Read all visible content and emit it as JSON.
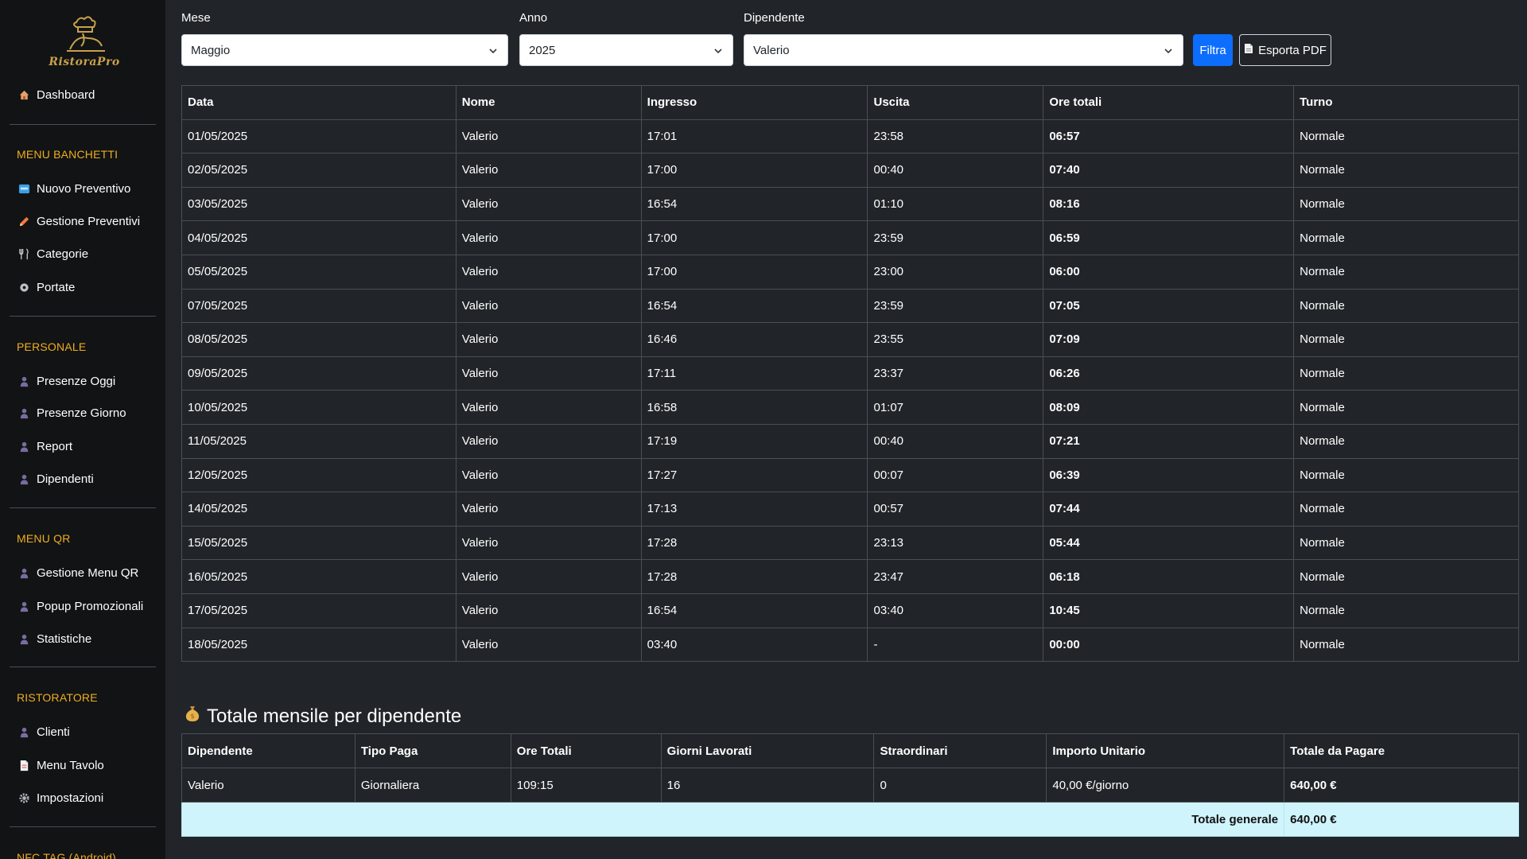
{
  "sidebar": {
    "logo_text": "RistoraPro",
    "dashboard": "Dashboard",
    "sections": [
      {
        "title": "MENU BANCHETTI",
        "items": [
          "Nuovo Preventivo",
          "Gestione Preventivi",
          "Categorie",
          "Portate"
        ]
      },
      {
        "title": "PERSONALE",
        "items": [
          "Presenze Oggi",
          "Presenze Giorno",
          "Report",
          "Dipendenti"
        ]
      },
      {
        "title": "MENU QR",
        "items": [
          "Gestione Menu QR",
          "Popup Promozionali",
          "Statistiche"
        ]
      },
      {
        "title": "RISTORATORE",
        "items": [
          "Clienti",
          "Menu Tavolo",
          "Impostazioni"
        ]
      },
      {
        "title": "NFC TAG (Android)"
      }
    ]
  },
  "filters": {
    "mese_label": "Mese",
    "mese_value": "Maggio",
    "anno_label": "Anno",
    "anno_value": "2025",
    "dip_label": "Dipendente",
    "dip_value": "Valerio",
    "filtra": "Filtra",
    "esporta": "Esporta PDF"
  },
  "attendance": {
    "headers": [
      "Data",
      "Nome",
      "Ingresso",
      "Uscita",
      "Ore totali",
      "Turno"
    ],
    "rows": [
      [
        "01/05/2025",
        "Valerio",
        "17:01",
        "23:58",
        "06:57",
        "Normale"
      ],
      [
        "02/05/2025",
        "Valerio",
        "17:00",
        "00:40",
        "07:40",
        "Normale"
      ],
      [
        "03/05/2025",
        "Valerio",
        "16:54",
        "01:10",
        "08:16",
        "Normale"
      ],
      [
        "04/05/2025",
        "Valerio",
        "17:00",
        "23:59",
        "06:59",
        "Normale"
      ],
      [
        "05/05/2025",
        "Valerio",
        "17:00",
        "23:00",
        "06:00",
        "Normale"
      ],
      [
        "07/05/2025",
        "Valerio",
        "16:54",
        "23:59",
        "07:05",
        "Normale"
      ],
      [
        "08/05/2025",
        "Valerio",
        "16:46",
        "23:55",
        "07:09",
        "Normale"
      ],
      [
        "09/05/2025",
        "Valerio",
        "17:11",
        "23:37",
        "06:26",
        "Normale"
      ],
      [
        "10/05/2025",
        "Valerio",
        "16:58",
        "01:07",
        "08:09",
        "Normale"
      ],
      [
        "11/05/2025",
        "Valerio",
        "17:19",
        "00:40",
        "07:21",
        "Normale"
      ],
      [
        "12/05/2025",
        "Valerio",
        "17:27",
        "00:07",
        "06:39",
        "Normale"
      ],
      [
        "14/05/2025",
        "Valerio",
        "17:13",
        "00:57",
        "07:44",
        "Normale"
      ],
      [
        "15/05/2025",
        "Valerio",
        "17:28",
        "23:13",
        "05:44",
        "Normale"
      ],
      [
        "16/05/2025",
        "Valerio",
        "17:28",
        "23:47",
        "06:18",
        "Normale"
      ],
      [
        "17/05/2025",
        "Valerio",
        "16:54",
        "03:40",
        "10:45",
        "Normale"
      ],
      [
        "18/05/2025",
        "Valerio",
        "03:40",
        "-",
        "00:00",
        "Normale"
      ]
    ]
  },
  "summary": {
    "title": "Totale mensile per dipendente",
    "headers": [
      "Dipendente",
      "Tipo Paga",
      "Ore Totali",
      "Giorni Lavorati",
      "Straordinari",
      "Importo Unitario",
      "Totale da Pagare"
    ],
    "row": [
      "Valerio",
      "Giornaliera",
      "109:15",
      "16",
      "0",
      "40,00 €/giorno",
      "640,00 €"
    ],
    "grand_label": "Totale generale",
    "grand_value": "640,00 €"
  }
}
